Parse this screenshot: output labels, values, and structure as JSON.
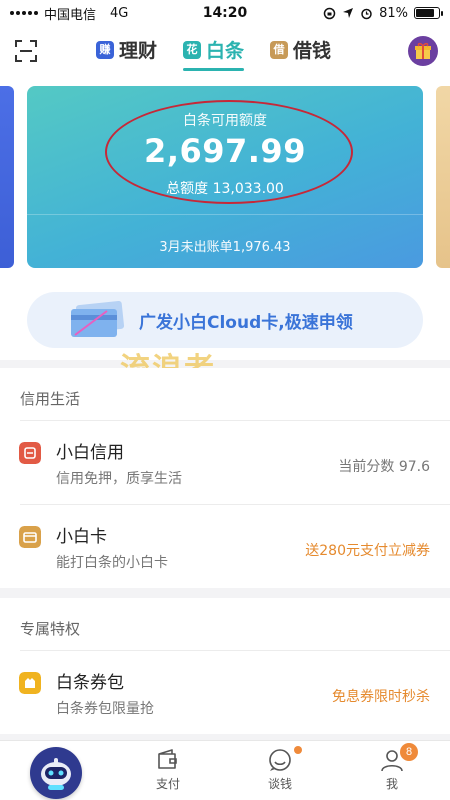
{
  "status_bar": {
    "carrier": "中国电信",
    "network": "4G",
    "time": "14:20",
    "battery_text": "81%",
    "battery_level": 0.81
  },
  "nav": {
    "tabs": [
      {
        "badge": "赚",
        "label": "理财",
        "badge_color": "#3a63d8"
      },
      {
        "badge": "花",
        "label": "白条",
        "badge_color": "#2bb3b0"
      },
      {
        "badge": "借",
        "label": "借钱",
        "badge_color": "#c79a58"
      }
    ],
    "active_tab": 1
  },
  "card": {
    "available_label": "白条可用额度",
    "available_amount": "2,697.99",
    "total_label": "总额度 13,033.00",
    "unbilled": "3月未出账单1,976.43"
  },
  "promo": {
    "text": "广发小白Cloud卡,极速申领"
  },
  "watermark": "流浪者",
  "sections": {
    "credit_life": {
      "title": "信用生活",
      "items": [
        {
          "title": "小白信用",
          "subtitle": "信用免押，质享生活",
          "right": "当前分数 97.6",
          "icon": "shield-icon",
          "color": "#e25a45"
        },
        {
          "title": "小白卡",
          "subtitle": "能打白条的小白卡",
          "right": "送280元支付立减券",
          "icon": "card-icon",
          "color": "#d9a14a"
        }
      ]
    },
    "privileges": {
      "title": "专属特权",
      "items": [
        {
          "title": "白条券包",
          "subtitle": "白条券包限量抢",
          "right": "免息券限时秒杀",
          "icon": "coupon-icon",
          "color": "#f0b320"
        }
      ]
    }
  },
  "tab_bar": {
    "tabs": [
      {
        "label": "支付",
        "icon": "wallet-icon"
      },
      {
        "label": "谈钱",
        "icon": "chat-icon"
      },
      {
        "label": "我",
        "icon": "user-icon"
      }
    ],
    "me_badge": "8"
  }
}
